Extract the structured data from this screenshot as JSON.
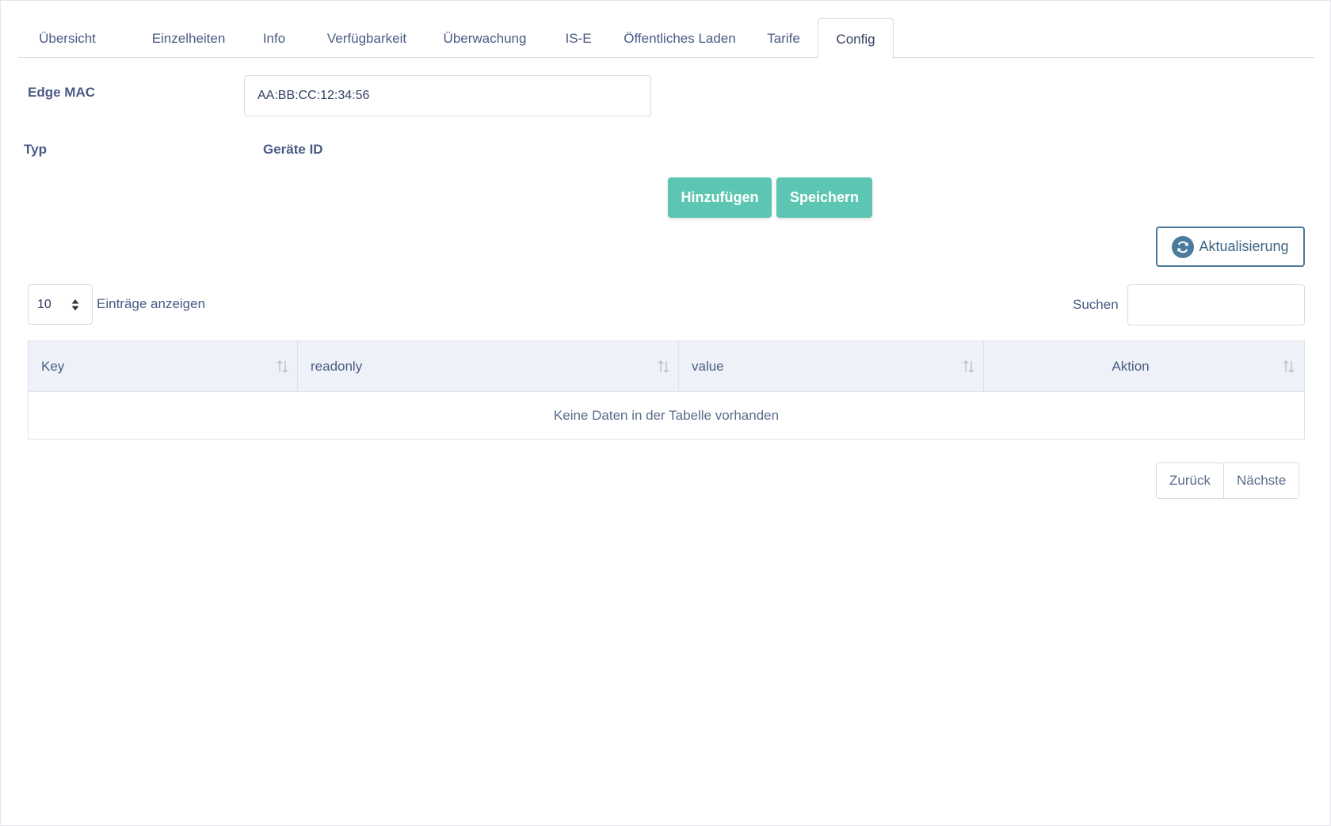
{
  "tabs": [
    {
      "label": "Übersicht",
      "active": false
    },
    {
      "label": "Einzelheiten",
      "active": false
    },
    {
      "label": "Info",
      "active": false
    },
    {
      "label": "Verfügbarkeit",
      "active": false
    },
    {
      "label": "Überwachung",
      "active": false
    },
    {
      "label": "IS-E",
      "active": false
    },
    {
      "label": "Öffentliches Laden",
      "active": false
    },
    {
      "label": "Tarife",
      "active": false
    },
    {
      "label": "Config",
      "active": true
    }
  ],
  "form": {
    "edge_mac_label": "Edge MAC",
    "edge_mac_value": "AA:BB:CC:12:34:56",
    "typ_label": "Typ",
    "geraete_id_label": "Geräte ID",
    "add_button": "Hinzufügen",
    "save_button": "Speichern"
  },
  "toolbar": {
    "refresh_button": "Aktualisierung",
    "refresh_icon": "refresh-icon"
  },
  "table_controls": {
    "page_length": "10",
    "page_length_label": "Einträge anzeigen",
    "search_label": "Suchen",
    "search_value": ""
  },
  "table": {
    "columns": [
      "Key",
      "readonly",
      "value",
      "Aktion"
    ],
    "empty_message": "Keine Daten in der Tabelle vorhanden"
  },
  "pagination": {
    "previous": "Zurück",
    "next": "Nächste"
  },
  "colors": {
    "accent_teal": "#5cc6b3",
    "refresh_blue": "#4c7a9c",
    "text": "#4a5a84",
    "table_header_bg": "#eef2f8"
  }
}
